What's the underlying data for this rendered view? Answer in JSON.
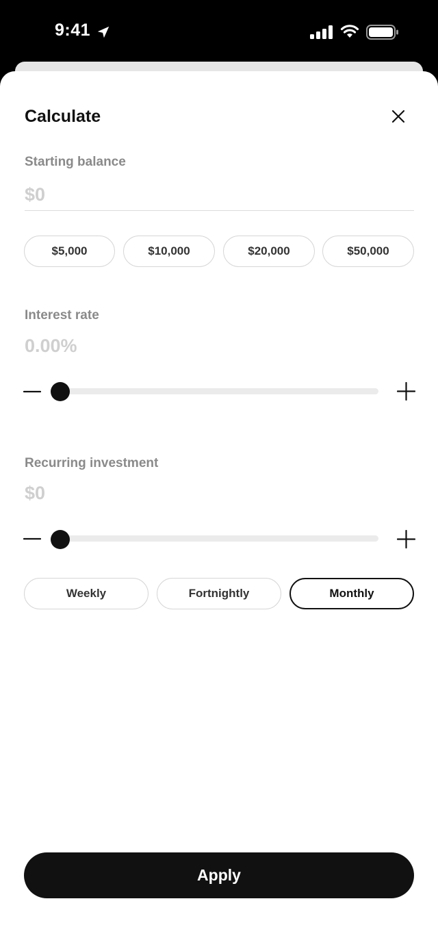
{
  "status": {
    "time": "9:41"
  },
  "sheet": {
    "title": "Calculate",
    "starting_balance": {
      "label": "Starting balance",
      "placeholder": "$0",
      "presets": [
        "$5,000",
        "$10,000",
        "$20,000",
        "$50,000"
      ]
    },
    "interest_rate": {
      "label": "Interest rate",
      "value": "0.00%",
      "slider_fraction": 0
    },
    "recurring_investment": {
      "label": "Recurring investment",
      "value": "$0",
      "slider_fraction": 0,
      "frequencies": [
        "Weekly",
        "Fortnightly",
        "Monthly"
      ],
      "selected_frequency": "Monthly"
    },
    "apply_label": "Apply"
  },
  "colors": {
    "primary": "#111111",
    "muted_label": "#8a8a8a",
    "placeholder": "#cfcfcf",
    "track": "#ebebeb"
  }
}
